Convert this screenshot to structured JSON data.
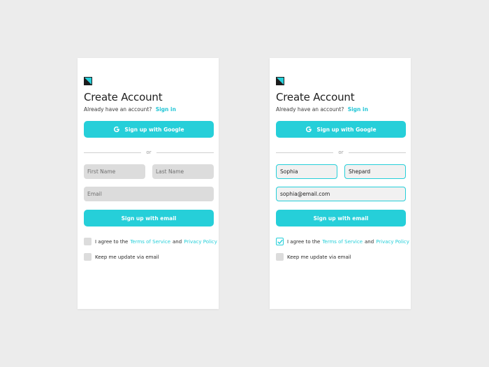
{
  "colors": {
    "accent": "#26cfd9",
    "background": "#ececec",
    "card": "#ffffff",
    "field_empty": "#dcdcdc"
  },
  "icons": {
    "logo": "logo-square-icon",
    "google": "google-g-icon",
    "check": "checkmark-icon"
  },
  "left_card": {
    "title": "Create Account",
    "have_account": "Already have an account?",
    "sign_in": "Sign in",
    "google_button": "Sign up with Google",
    "divider_text": "or",
    "first_name_placeholder": "First Name",
    "last_name_placeholder": "Last Name",
    "email_placeholder": "Email",
    "email_button": "Sign up with email",
    "agree_prefix": "I agree to the",
    "terms": "Terms of Service",
    "and": "and",
    "privacy": "Privacy Policy",
    "agree_checked": false,
    "keep_update": "Keep me update via email",
    "update_checked": false
  },
  "right_card": {
    "title": "Create Account",
    "have_account": "Already have an account?",
    "sign_in": "Sign in",
    "google_button": "Sign up with Google",
    "divider_text": "or",
    "first_name_value": "Sophia",
    "last_name_value": "Shepard",
    "email_value": "sophia@email.com",
    "email_button": "Sign up with email",
    "agree_prefix": "I agree to the",
    "terms": "Terms of Service",
    "and": "and",
    "privacy": "Privacy Policy",
    "agree_checked": true,
    "keep_update": "Keep me update via email",
    "update_checked": false
  }
}
